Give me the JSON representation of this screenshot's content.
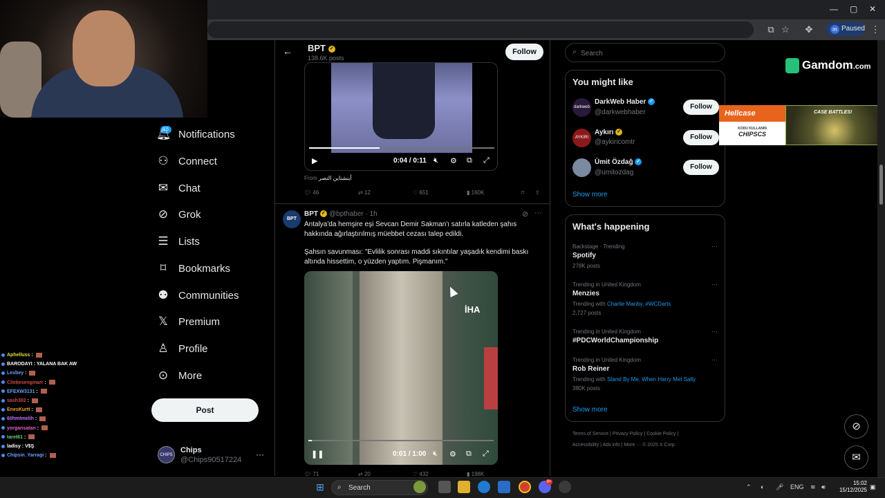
{
  "browser": {
    "window_controls": [
      "—",
      "▢",
      "✕"
    ],
    "profile_initial": "m",
    "profile_status": "Paused"
  },
  "nav": {
    "notifications_badge": "15",
    "items": [
      {
        "label": "Notifications",
        "icon": "bell-icon"
      },
      {
        "label": "Connect",
        "icon": "person-add-icon"
      },
      {
        "label": "Chat",
        "icon": "mail-icon"
      },
      {
        "label": "Grok",
        "icon": "grok-icon"
      },
      {
        "label": "Lists",
        "icon": "list-icon"
      },
      {
        "label": "Bookmarks",
        "icon": "bookmark-icon"
      },
      {
        "label": "Communities",
        "icon": "communities-icon"
      },
      {
        "label": "Premium",
        "icon": "x-logo-icon"
      },
      {
        "label": "Profile",
        "icon": "person-icon"
      },
      {
        "label": "More",
        "icon": "more-circle-icon"
      }
    ],
    "post_label": "Post",
    "account": {
      "name": "Chips",
      "handle": "@Chips90517224",
      "avatar_text": "CHIPS"
    }
  },
  "chat": [
    {
      "user": "Aphelluss",
      "msg": "",
      "color": "#e0e040"
    },
    {
      "user": "BARODAYI",
      "msg": "YALANA BAK AW",
      "color": "#ffffff"
    },
    {
      "user": "Lexbey",
      "msg": "",
      "color": "#6aa0ff"
    },
    {
      "user": "Cilekesenginarr",
      "msg": "",
      "color": "#d04a4a"
    },
    {
      "user": "EFEXW3131",
      "msg": "",
      "color": "#6aa0ff"
    },
    {
      "user": "sash302",
      "msg": "",
      "color": "#d04a4a"
    },
    {
      "user": "EnesKurtt",
      "msg": "",
      "color": "#f0a030"
    },
    {
      "user": "60hmtmelih",
      "msg": "",
      "color": "#c070ff"
    },
    {
      "user": "yorgansatan",
      "msg": "",
      "color": "#e060c0"
    },
    {
      "user": "taret61",
      "msg": "",
      "color": "#6ad06a"
    },
    {
      "user": "ladisy",
      "msg": "V$Ş",
      "color": "#ffffff"
    },
    {
      "user": "Chipsin_Yarragi",
      "msg": "",
      "color": "#6aa0ff"
    }
  ],
  "header": {
    "title": "BPT",
    "posts": "138.6K posts",
    "follow_label": "Follow",
    "back_icon": "back-arrow-icon"
  },
  "tweet1": {
    "video_time": "0:04 / 0:11",
    "progress": 0.38,
    "from_label": "From",
    "from_source": "أينشتاين النصر",
    "replies": "46",
    "reposts": "12",
    "likes": "651",
    "views": "160K"
  },
  "tweet2": {
    "avatar_text": "BPT",
    "name": "BPT",
    "handle": "@bpthaber · 1h",
    "text1": "Antalya'da hemşire eşi Sevcan Demir Sakman'ı satırla katleden şahıs hakkında ağırlaştırılmış müebbet cezası talep edildi.",
    "text2": "Şahsın savunması: \"Evlilik sonrası maddi sıkıntılar yaşadık kendimi baskı altında hissettim, o yüzden yaptım. Pişmanım.\"",
    "video_logo": "İHA",
    "video_time": "0:01 / 1:00",
    "progress": 0.02,
    "replies": "71",
    "reposts": "20",
    "likes": "432",
    "views": "198K"
  },
  "search": {
    "placeholder": "Search"
  },
  "you_might_like": {
    "title": "You might like",
    "follow_label": "Follow",
    "show_more": "Show more",
    "users": [
      {
        "name": "DarkWeb Haber",
        "handle": "@darkwebhaber",
        "badge": "blue",
        "avatar_text": "darkweb",
        "avatar_color": "#2a1a3a"
      },
      {
        "name": "Aykırı",
        "handle": "@aykiricomtr",
        "badge": "gold",
        "avatar_text": "AYKIRI",
        "avatar_color": "#8a1a1a"
      },
      {
        "name": "Ümit Özdağ",
        "handle": "@umitozdag",
        "badge": "blue",
        "avatar_text": "",
        "avatar_color": "#7a8aa0"
      }
    ]
  },
  "whats_happening": {
    "title": "What's happening",
    "show_more": "Show more",
    "trends": [
      {
        "context": "Backstage · Trending",
        "name": "Spotify",
        "with_label": "",
        "with_links": "",
        "posts": "278K posts"
      },
      {
        "context": "Trending in United Kingdom",
        "name": "Menzies",
        "with_label": "Trending with",
        "with_links": "Charlie Manby, #WCDarts",
        "posts": "2,727 posts"
      },
      {
        "context": "Trending in United Kingdom",
        "name": "#PDCWorldChampionship",
        "with_label": "",
        "with_links": "",
        "posts": ""
      },
      {
        "context": "Trending in United Kingdom",
        "name": "Rob Reiner",
        "with_label": "Trending with",
        "with_links": "Stand By Me, When Harry Met Sally",
        "posts": "380K posts"
      }
    ]
  },
  "footer": {
    "line1": "Terms of Service  |   Privacy Policy  |   Cookie Policy  |",
    "line2": "Accessibility  |   Ads info  |   More ···   © 2025 X Corp."
  },
  "ads": {
    "gamdom_name": "Gamdom",
    "gamdom_tld": ".com",
    "hellcase_title": "Hellcase",
    "hellcase_line1": "KODU KULLANIN",
    "hellcase_line2": "CHIPSCS",
    "casebattles_title": "CASE BATTLES!"
  },
  "taskbar": {
    "search_label": "Search",
    "lang": "ENG",
    "time": "15:02",
    "date": "15/12/2025",
    "discord_badge": "9+"
  }
}
